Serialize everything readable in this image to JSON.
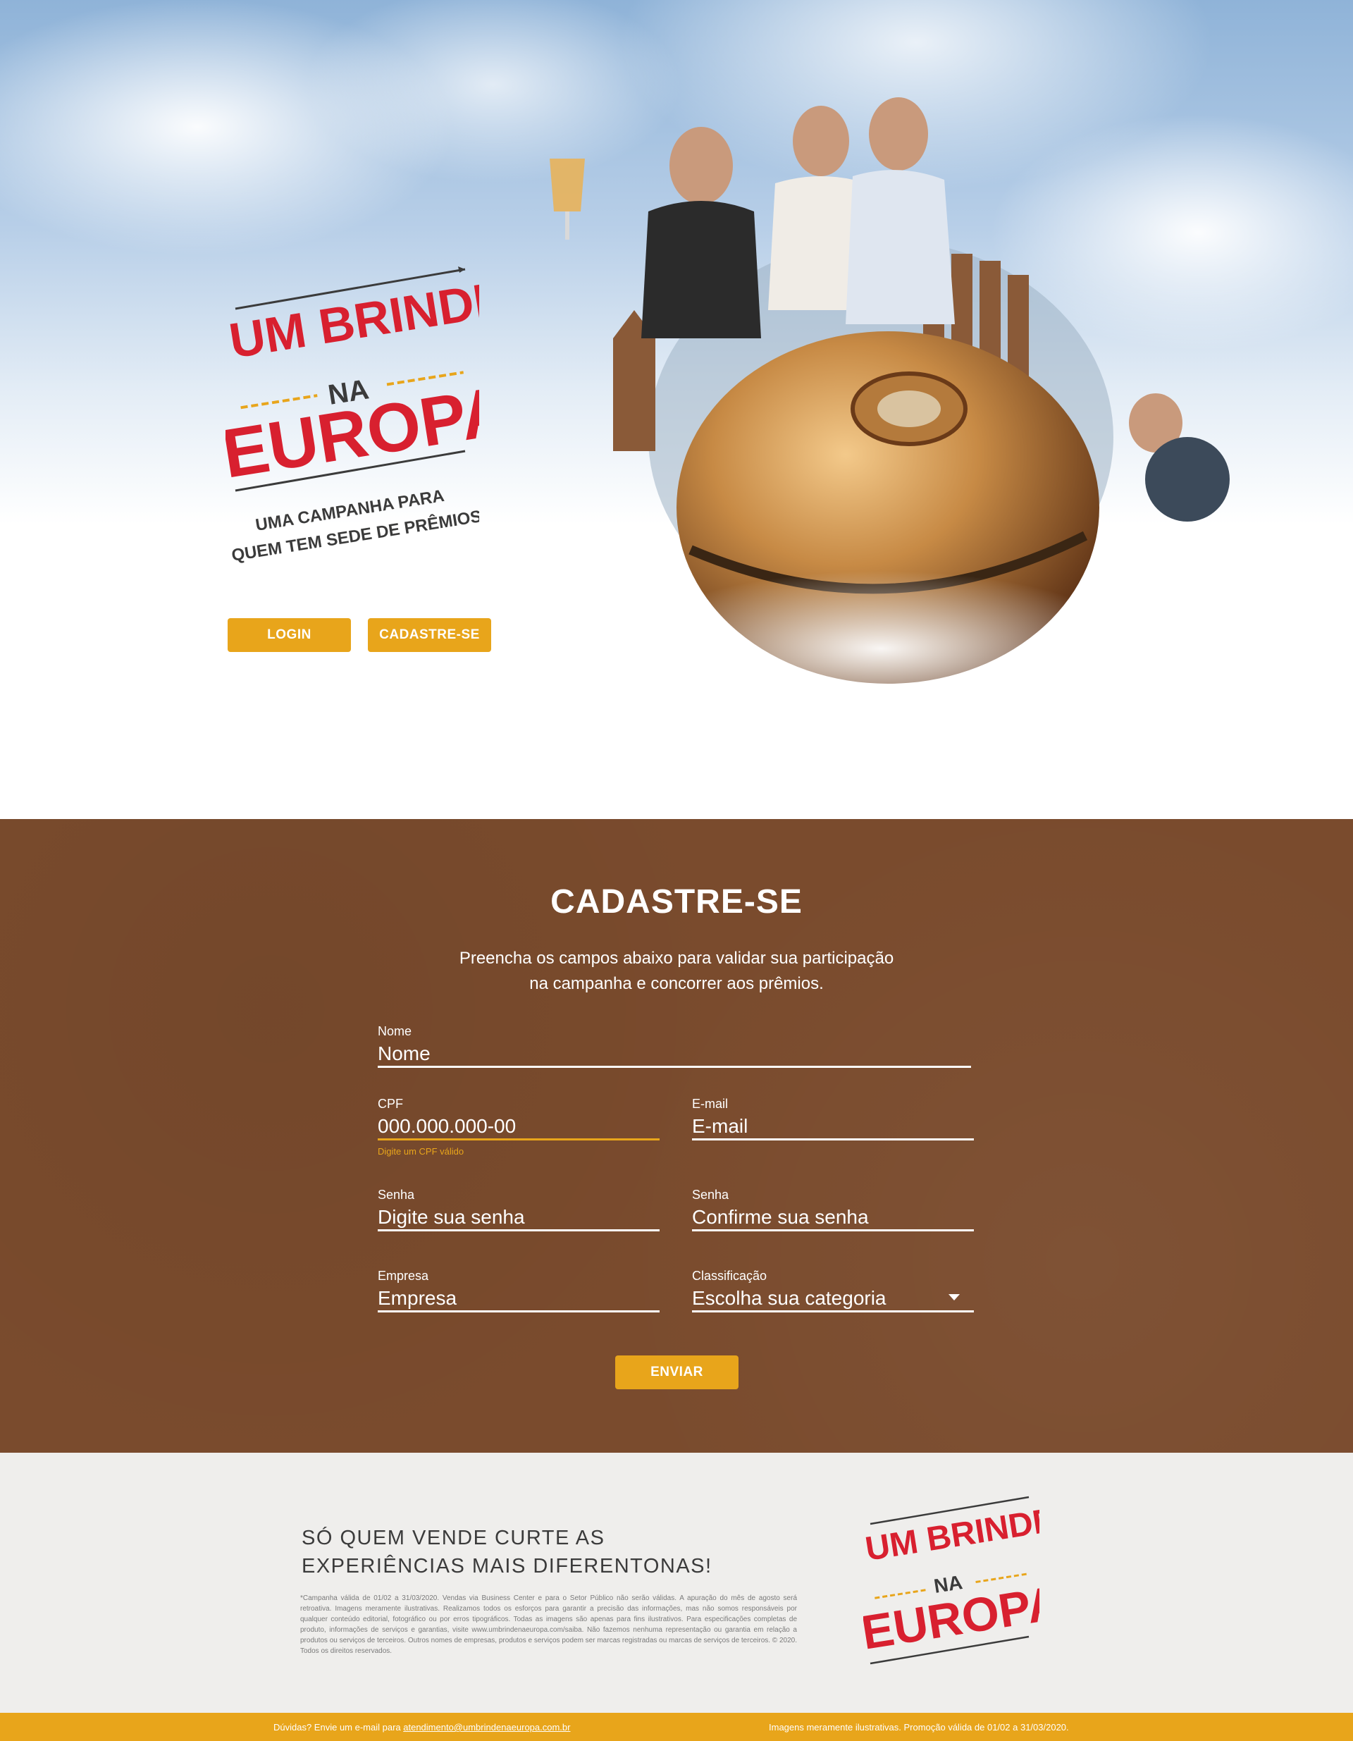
{
  "colors": {
    "accent": "#e8a51b",
    "brand_red": "#d8202f",
    "brown": "#7a4b2d",
    "dark_text": "#3b3b3b"
  },
  "logo": {
    "line1": "UM BRINDE",
    "line2": "NA",
    "line3": "EUROPA",
    "tagline1": "UMA CAMPANHA PARA",
    "tagline2": "QUEM TEM SEDE DE PRÊMIOS"
  },
  "hero": {
    "login_label": "LOGIN",
    "signup_label": "CADASTRE-SE"
  },
  "form": {
    "title": "CADASTRE-SE",
    "subtitle_line1": "Preencha os campos abaixo para validar sua participação",
    "subtitle_line2": "na campanha e concorrer aos prêmios.",
    "fields": {
      "nome": {
        "label": "Nome",
        "placeholder": "Nome"
      },
      "cpf": {
        "label": "CPF",
        "placeholder": "000.000.000-00",
        "error": "Digite um CPF válido"
      },
      "email": {
        "label": "E-mail",
        "placeholder": "E-mail"
      },
      "senha": {
        "label": "Senha",
        "placeholder": "Digite sua senha"
      },
      "confirma": {
        "label": "Senha",
        "placeholder": "Confirme sua senha"
      },
      "empresa": {
        "label": "Empresa",
        "placeholder": "Empresa"
      },
      "classificacao": {
        "label": "Classificação",
        "selected": "Escolha sua categoria"
      }
    },
    "submit_label": "ENVIAR"
  },
  "footer": {
    "slogan_line1": "SÓ QUEM VENDE CURTE AS",
    "slogan_line2": "EXPERIÊNCIAS MAIS DIFERENTONAS!",
    "legal": "*Campanha válida de 01/02 a 31/03/2020. Vendas via Business Center e para o Setor Público não serão válidas. A apuração do mês de agosto será retroativa. Imagens meramente ilustrativas. Realizamos todos os esforços para garantir a precisão das informações, mas não somos responsáveis por qualquer conteúdo editorial, fotográfico ou por erros tipográficos. Todas as imagens são apenas para fins ilustrativos. Para especificações completas de produto, informações de serviços e garantias, visite www.umbrindenaeuropa.com/saiba. Não fazemos nenhuma representação ou garantia em relação a produtos ou serviços de terceiros. Outros nomes de empresas, produtos e serviços podem ser marcas registradas ou marcas de serviços de terceiros. © 2020. Todos os direitos reservados."
  },
  "bottom_bar": {
    "doubt_text": "Dúvidas? Envie um e-mail para ",
    "email": "atendimento@umbrindenaeuropa.com.br",
    "notice": "Imagens meramente ilustrativas. Promoção válida de 01/02 a 31/03/2020."
  }
}
